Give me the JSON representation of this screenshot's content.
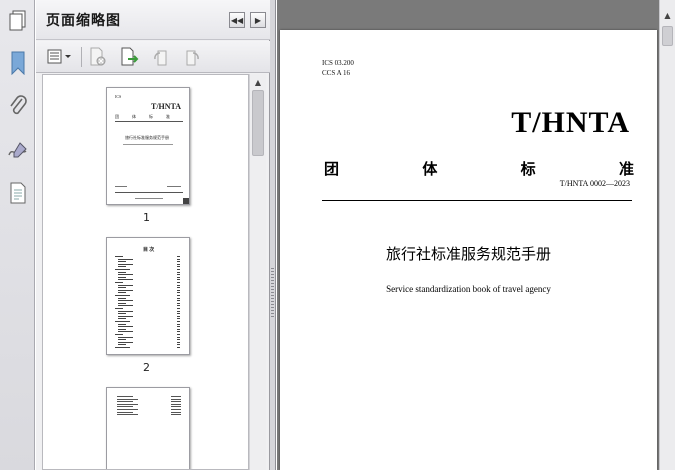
{
  "panel": {
    "title": "页面缩略图",
    "thumbnails": [
      {
        "page_number": "1",
        "brand": "T/HNTA",
        "title_cn": "旅行社标准服务规范手册"
      },
      {
        "page_number": "2",
        "heading": "目 次"
      },
      {
        "page_number": ""
      }
    ]
  },
  "document": {
    "ics_code": "ICS 03.200",
    "ccs_code": "CCS A 16",
    "brand": "T/HNTA",
    "standard_type_chars": [
      "团",
      "体",
      "标",
      "准"
    ],
    "standard_number": "T/HNTA 0002—2023",
    "title_cn": "旅行社标准服务规范手册",
    "title_en": "Service standardization book of travel agency"
  },
  "icons": {
    "rail": [
      "pages-icon",
      "bookmark-icon",
      "attachment-icon",
      "signature-icon",
      "layers-icon"
    ],
    "toolbar": [
      "options-menu-icon",
      "delete-page-icon",
      "extract-page-icon",
      "rotate-ccw-icon",
      "rotate-cw-icon"
    ]
  },
  "colors": {
    "workspace": "#7a7a7a",
    "panel_bg": "#f0f0f2",
    "bookmark_blue": "#6f9fd0"
  }
}
